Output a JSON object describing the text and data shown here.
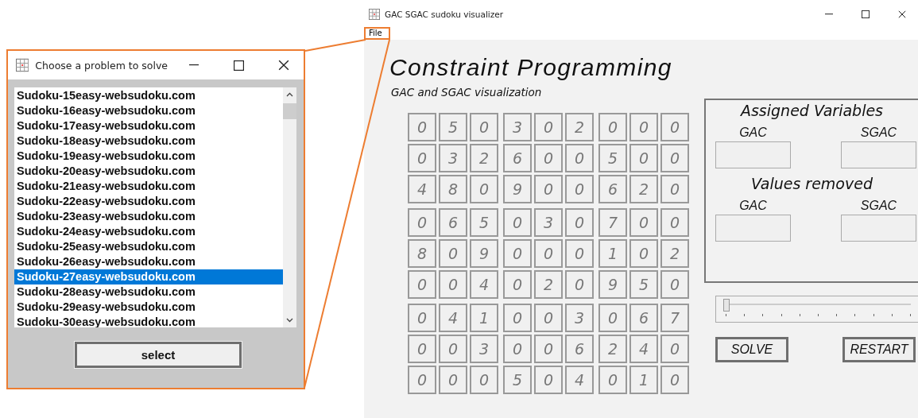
{
  "dialog": {
    "title": "Choose a problem to solve",
    "items": [
      {
        "label": "Sudoku-15easy-websudoku.com",
        "selected": false
      },
      {
        "label": "Sudoku-16easy-websudoku.com",
        "selected": false
      },
      {
        "label": "Sudoku-17easy-websudoku.com",
        "selected": false
      },
      {
        "label": "Sudoku-18easy-websudoku.com",
        "selected": false
      },
      {
        "label": "Sudoku-19easy-websudoku.com",
        "selected": false
      },
      {
        "label": "Sudoku-20easy-websudoku.com",
        "selected": false
      },
      {
        "label": "Sudoku-21easy-websudoku.com",
        "selected": false
      },
      {
        "label": "Sudoku-22easy-websudoku.com",
        "selected": false
      },
      {
        "label": "Sudoku-23easy-websudoku.com",
        "selected": false
      },
      {
        "label": "Sudoku-24easy-websudoku.com",
        "selected": false
      },
      {
        "label": "Sudoku-25easy-websudoku.com",
        "selected": false
      },
      {
        "label": "Sudoku-26easy-websudoku.com",
        "selected": false
      },
      {
        "label": "Sudoku-27easy-websudoku.com",
        "selected": true
      },
      {
        "label": "Sudoku-28easy-websudoku.com",
        "selected": false
      },
      {
        "label": "Sudoku-29easy-websudoku.com",
        "selected": false
      },
      {
        "label": "Sudoku-30easy-websudoku.com",
        "selected": false
      }
    ],
    "button": "select"
  },
  "window": {
    "title": "GAC SGAC sudoku visualizer",
    "menu": [
      "File"
    ]
  },
  "heading": "Constraint Programming",
  "subheading": "GAC and SGAC visualization",
  "grid": [
    [
      "0",
      "5",
      "0",
      "3",
      "0",
      "2",
      "0",
      "0",
      "0"
    ],
    [
      "0",
      "3",
      "2",
      "6",
      "0",
      "0",
      "5",
      "0",
      "0"
    ],
    [
      "4",
      "8",
      "0",
      "9",
      "0",
      "0",
      "6",
      "2",
      "0"
    ],
    [
      "0",
      "6",
      "5",
      "0",
      "3",
      "0",
      "7",
      "0",
      "0"
    ],
    [
      "8",
      "0",
      "9",
      "0",
      "0",
      "0",
      "1",
      "0",
      "2"
    ],
    [
      "0",
      "0",
      "4",
      "0",
      "2",
      "0",
      "9",
      "5",
      "0"
    ],
    [
      "0",
      "4",
      "1",
      "0",
      "0",
      "3",
      "0",
      "6",
      "7"
    ],
    [
      "0",
      "0",
      "3",
      "0",
      "0",
      "6",
      "2",
      "4",
      "0"
    ],
    [
      "0",
      "0",
      "0",
      "5",
      "0",
      "4",
      "0",
      "1",
      "0"
    ]
  ],
  "stats": [
    {
      "title": "Assigned Variables",
      "fields": [
        "GAC",
        "SGAC"
      ]
    },
    {
      "title": "Values removed",
      "fields": [
        "GAC",
        "SGAC"
      ]
    }
  ],
  "slider": {
    "level": 0
  },
  "buttons": [
    "SOLVE",
    "RESTART"
  ]
}
